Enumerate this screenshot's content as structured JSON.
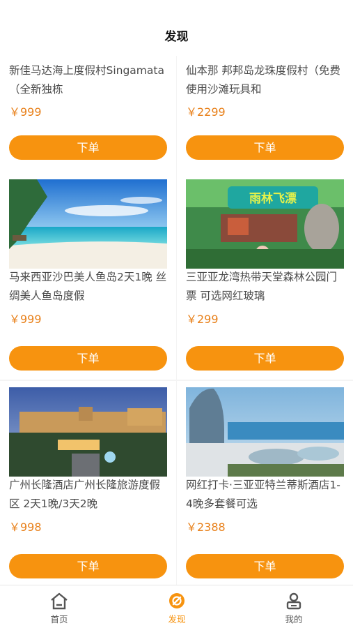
{
  "header": {
    "title": "发现"
  },
  "products": [
    {
      "name": "新佳马达海上度假村Singamata（全新独栋",
      "price": "￥999",
      "button": "下单"
    },
    {
      "name": "仙本那 邦邦岛龙珠度假村（免费使用沙滩玩具和",
      "price": "￥2299",
      "button": "下单"
    },
    {
      "name": "马来西亚沙巴美人鱼岛2天1晚 丝绸美人鱼岛度假",
      "price": "￥999",
      "button": "下单"
    },
    {
      "name": "三亚亚龙湾热带天堂森林公园门票 可选网红玻璃",
      "price": "￥299",
      "button": "下单"
    },
    {
      "name": "广州长隆酒店广州长隆旅游度假区 2天1晚/3天2晚",
      "price": "￥998",
      "button": "下单"
    },
    {
      "name": "网红打卡·三亚亚特兰蒂斯酒店1-4晚多套餐可选",
      "price": "￥2388",
      "button": "下单"
    }
  ],
  "images": {
    "img_2_sign_text": "雨林飞漂"
  },
  "tabbar": [
    {
      "label": "首页",
      "icon": "home-icon",
      "active": false
    },
    {
      "label": "发现",
      "icon": "discover-icon",
      "active": true
    },
    {
      "label": "我的",
      "icon": "profile-icon",
      "active": false
    }
  ],
  "colors": {
    "accent": "#f7930f",
    "price": "#e8801a"
  }
}
